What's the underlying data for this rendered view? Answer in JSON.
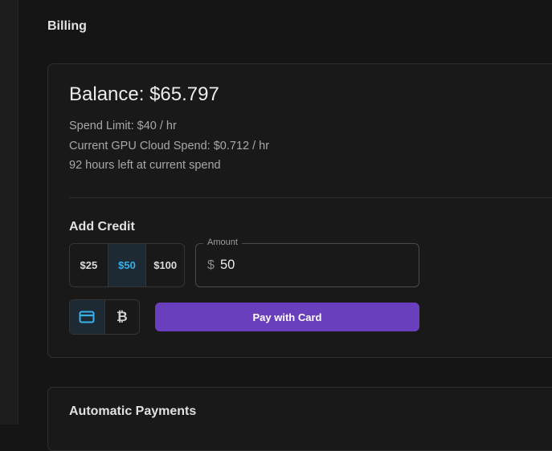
{
  "page": {
    "title": "Billing"
  },
  "balance_card": {
    "balance": "Balance: $65.797",
    "spend_limit": "Spend Limit: $40 / hr",
    "current_spend": "Current GPU Cloud Spend: $0.712 / hr",
    "hours_left": "92 hours left at current spend"
  },
  "add_credit": {
    "title": "Add Credit",
    "presets": [
      "$25",
      "$50",
      "$100"
    ],
    "selected_preset": "$50",
    "amount": {
      "label": "Amount",
      "prefix": "$",
      "value": "50"
    },
    "payment_methods": [
      {
        "icon": "credit-card-icon",
        "selected": true
      },
      {
        "icon": "bitcoin-icon",
        "selected": false
      }
    ],
    "pay_button": "Pay with Card"
  },
  "automatic_payments": {
    "title": "Automatic Payments"
  },
  "colors": {
    "background": "#151515",
    "card": "#191919",
    "accent_blue": "#38b0ea",
    "accent_purple": "#6a3fbd"
  }
}
